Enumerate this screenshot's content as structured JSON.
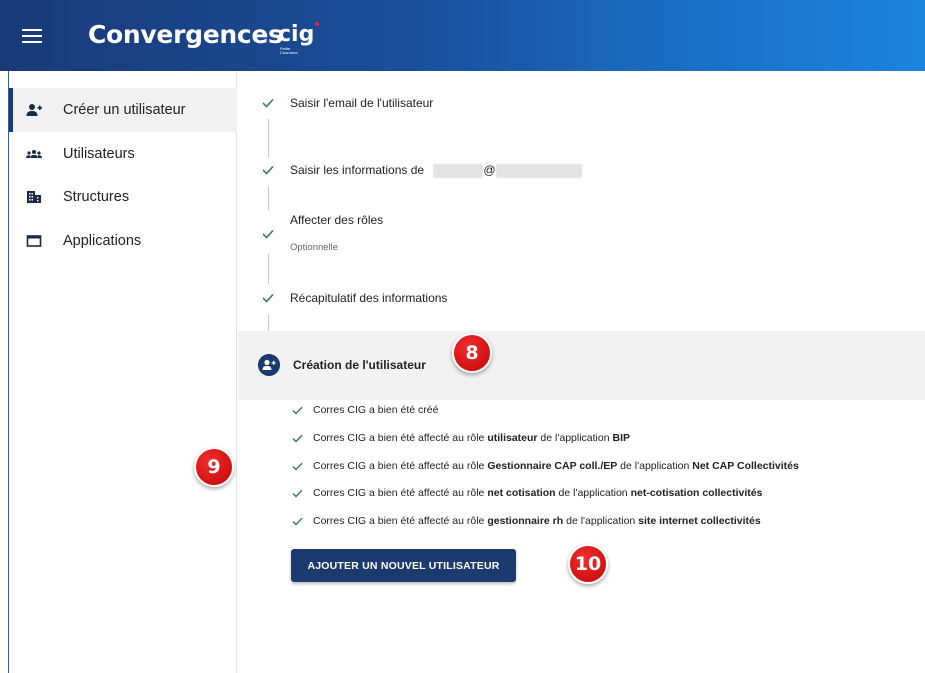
{
  "header": {
    "app_title": "Convergences",
    "logo_text": "cig",
    "logo_subtext": "Petite Couronne",
    "menu_icon": "hamburger-menu-icon"
  },
  "colors": {
    "header_gradient_start": "#1a3a78",
    "header_gradient_end": "#1c84de",
    "primary": "#1b3a6e",
    "badge_red": "#d11010",
    "check_green": "#2e7d4f"
  },
  "sidebar": {
    "items": [
      {
        "label": "Créer un utilisateur",
        "icon": "add-user-icon",
        "active": true
      },
      {
        "label": "Utilisateurs",
        "icon": "users-icon",
        "active": false
      },
      {
        "label": "Structures",
        "icon": "building-icon",
        "active": false
      },
      {
        "label": "Applications",
        "icon": "window-icon",
        "active": false
      }
    ]
  },
  "stepper": {
    "steps": [
      {
        "label": "Saisir l'email de l'utilisateur",
        "status": "done"
      },
      {
        "label": "Saisir les informations de",
        "redacted_email_separator": "@",
        "status": "done"
      },
      {
        "label": "Affecter des rôles",
        "sublabel": "Optionnelle",
        "status": "done"
      },
      {
        "label": "Récapitulatif des informations",
        "status": "done"
      }
    ],
    "active_step": {
      "label": "Création de l'utilisateur",
      "icon": "add-user-icon"
    }
  },
  "results": [
    {
      "parts": [
        {
          "text": "Corres CIG a bien été créé",
          "bold": false
        }
      ]
    },
    {
      "parts": [
        {
          "text": "Corres CIG a bien été affecté au rôle ",
          "bold": false
        },
        {
          "text": "utilisateur",
          "bold": true
        },
        {
          "text": " de l'application ",
          "bold": false
        },
        {
          "text": "BIP",
          "bold": true
        }
      ]
    },
    {
      "parts": [
        {
          "text": "Corres CIG a bien été affecté au rôle ",
          "bold": false
        },
        {
          "text": "Gestionnaire CAP coll./EP",
          "bold": true
        },
        {
          "text": " de l'application ",
          "bold": false
        },
        {
          "text": "Net CAP Collectivités",
          "bold": true
        }
      ]
    },
    {
      "parts": [
        {
          "text": "Corres CIG a bien été affecté au rôle ",
          "bold": false
        },
        {
          "text": "net cotisation",
          "bold": true
        },
        {
          "text": " de l'application ",
          "bold": false
        },
        {
          "text": "net-cotisation collectivités",
          "bold": true
        }
      ]
    },
    {
      "parts": [
        {
          "text": "Corres CIG a bien été affecté au rôle ",
          "bold": false
        },
        {
          "text": "gestionnaire rh",
          "bold": true
        },
        {
          "text": " de l'application ",
          "bold": false
        },
        {
          "text": "site internet collectivités",
          "bold": true
        }
      ]
    }
  ],
  "add_button_label": "AJOUTER UN NOUVEL UTILISATEUR",
  "annotations": {
    "badge_8": "8",
    "badge_9": "9",
    "badge_10": "10"
  }
}
